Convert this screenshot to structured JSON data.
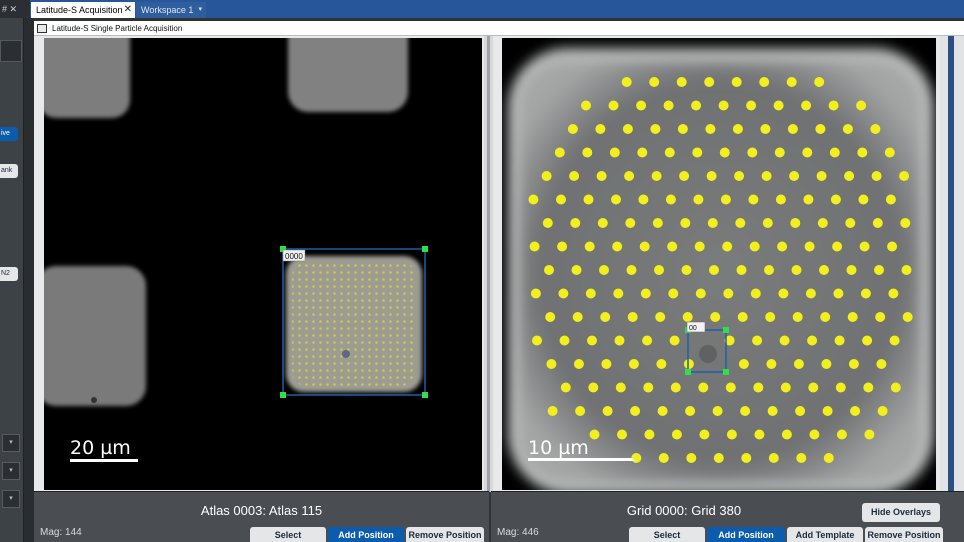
{
  "tabs": [
    {
      "label": "Latitude-S Acquisition",
      "close": "✕",
      "active": true
    },
    {
      "label": "Workspace 1",
      "more": "▾",
      "active": false
    }
  ],
  "tab_icons": "# ✕",
  "sidebar": {
    "buttons": [
      "ive",
      "ank",
      "N2"
    ]
  },
  "subheader": {
    "title": "Latitude-S  Single Particle Acquisition"
  },
  "left_panel": {
    "title": "Atlas 0003: Atlas 115",
    "mag": "Mag: 144",
    "scalebar": "20 µm",
    "selection_label": "0000",
    "buttons": {
      "select": "Select",
      "add_position": "Add Position",
      "remove_position": "Remove Position"
    }
  },
  "right_panel": {
    "title": "Grid 0000: Grid 380",
    "mag": "Mag: 446",
    "scalebar": "10 µm",
    "selection_label": "00",
    "hide_overlays": "Hide Overlays",
    "buttons": {
      "select": "Select",
      "add_position": "Add Position",
      "add_template": "Add Template",
      "remove_position": "Remove Position"
    }
  },
  "colors": {
    "accent_blue": "#0b5cad",
    "tab_blue": "#27579a",
    "hole_yellow": "#f2ef1d",
    "selection_blue": "#1e5fa8",
    "corner_green": "#2ee04a"
  }
}
